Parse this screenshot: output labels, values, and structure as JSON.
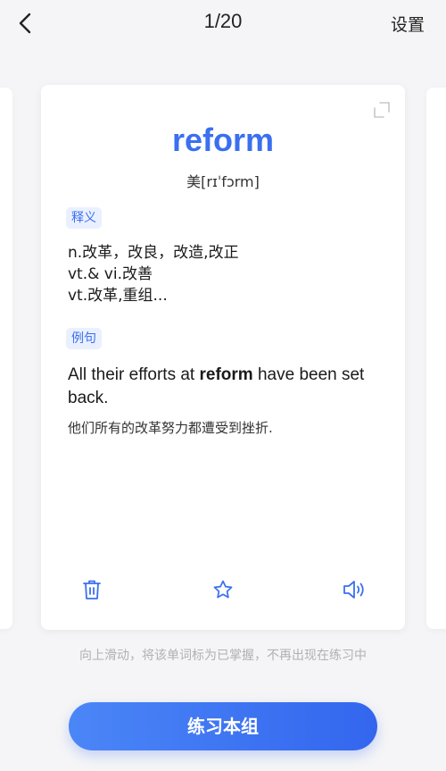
{
  "header": {
    "back_icon": "chevron-left-icon",
    "counter": "1/20",
    "settings_label": "设置"
  },
  "card": {
    "expand_icon": "expand-icon",
    "word": "reform",
    "phonetic": "美[rɪˈfɔrm]",
    "meaning_tag": "释义",
    "meanings": [
      "n.改革，改良，改造,改正",
      "vt.& vi.改善",
      "vt.改革,重组..."
    ],
    "example_tag": "例句",
    "example_en_pre": "All their efforts at ",
    "example_en_bold": "reform",
    "example_en_post": " have been set back.",
    "example_zh": "他们所有的改革努力都遭受到挫折.",
    "actions": {
      "delete_icon": "trash-icon",
      "star_icon": "star-icon",
      "sound_icon": "speaker-icon"
    }
  },
  "hint": "向上滑动，将该单词标为已掌握，不再出现在练习中",
  "practice_button_label": "练习本组",
  "colors": {
    "accent": "#3a6ff0",
    "tag_bg": "#eaf0ff",
    "hint": "#b0b0b6"
  }
}
